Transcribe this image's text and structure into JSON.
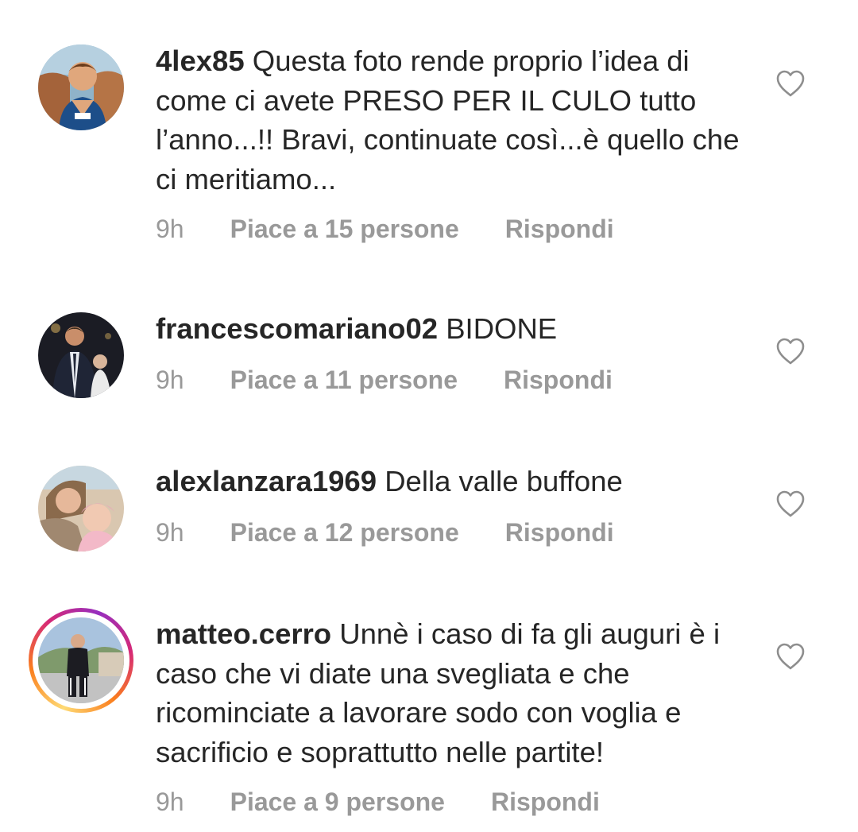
{
  "comments": [
    {
      "username": "4lex85",
      "text": "Questa foto rende proprio l’idea di come ci avete PRESO PER IL CULO tutto l’anno...!! Bravi, continuate così...è quello che ci meritiamo...",
      "time": "9h",
      "likes": "Piace a 15 persone",
      "reply": "Rispondi",
      "avatar_icon": "user-avatar-photo",
      "heart_icon": "heart-outline-icon"
    },
    {
      "username": "francescomariano02",
      "text": "BIDONE",
      "time": "9h",
      "likes": "Piace a 11 persone",
      "reply": "Rispondi",
      "avatar_icon": "user-avatar-photo",
      "heart_icon": "heart-outline-icon"
    },
    {
      "username": "alexlanzara1969",
      "text": "Della valle buffone",
      "time": "9h",
      "likes": "Piace a 12 persone",
      "reply": "Rispondi",
      "avatar_icon": "user-avatar-photo",
      "heart_icon": "heart-outline-icon"
    },
    {
      "username": "matteo.cerro",
      "text": "Unnè i caso di fa gli auguri è i caso che vi diate una svegliata e che ricominciate a lavorare sodo con voglia e sacrificio e soprattutto nelle partite!",
      "time": "9h",
      "likes": "Piace a 9 persone",
      "reply": "Rispondi",
      "avatar_icon": "user-avatar-photo-with-story-ring",
      "heart_icon": "heart-outline-icon"
    }
  ],
  "colors": {
    "text": "#262626",
    "meta": "#999999",
    "story_ring": [
      "#feda75",
      "#fa7e1e",
      "#d62976",
      "#962fbf"
    ]
  }
}
